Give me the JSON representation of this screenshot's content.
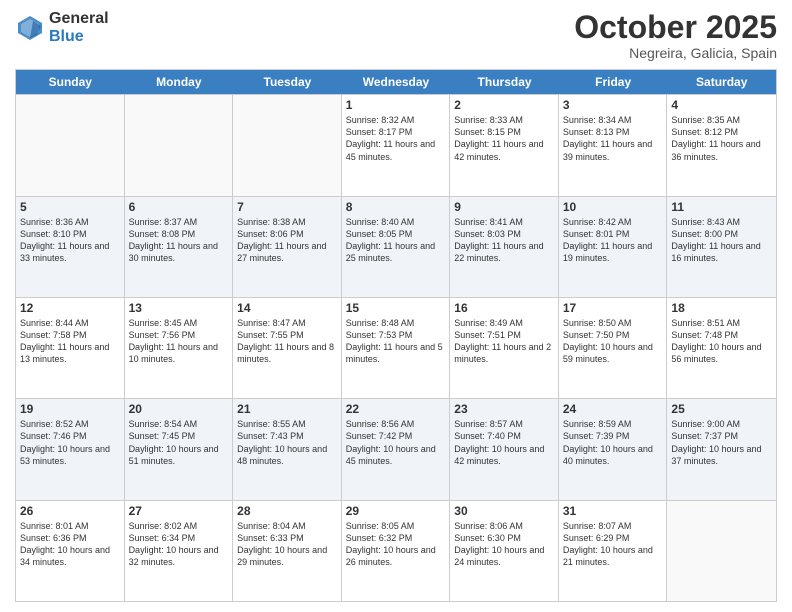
{
  "header": {
    "logo_general": "General",
    "logo_blue": "Blue",
    "month_title": "October 2025",
    "location": "Negreira, Galicia, Spain"
  },
  "calendar": {
    "days_of_week": [
      "Sunday",
      "Monday",
      "Tuesday",
      "Wednesday",
      "Thursday",
      "Friday",
      "Saturday"
    ],
    "rows": [
      [
        {
          "day": "",
          "empty": true
        },
        {
          "day": "",
          "empty": true
        },
        {
          "day": "",
          "empty": true
        },
        {
          "day": "1",
          "sunrise": "Sunrise: 8:32 AM",
          "sunset": "Sunset: 8:17 PM",
          "daylight": "Daylight: 11 hours and 45 minutes."
        },
        {
          "day": "2",
          "sunrise": "Sunrise: 8:33 AM",
          "sunset": "Sunset: 8:15 PM",
          "daylight": "Daylight: 11 hours and 42 minutes."
        },
        {
          "day": "3",
          "sunrise": "Sunrise: 8:34 AM",
          "sunset": "Sunset: 8:13 PM",
          "daylight": "Daylight: 11 hours and 39 minutes."
        },
        {
          "day": "4",
          "sunrise": "Sunrise: 8:35 AM",
          "sunset": "Sunset: 8:12 PM",
          "daylight": "Daylight: 11 hours and 36 minutes."
        }
      ],
      [
        {
          "day": "5",
          "sunrise": "Sunrise: 8:36 AM",
          "sunset": "Sunset: 8:10 PM",
          "daylight": "Daylight: 11 hours and 33 minutes."
        },
        {
          "day": "6",
          "sunrise": "Sunrise: 8:37 AM",
          "sunset": "Sunset: 8:08 PM",
          "daylight": "Daylight: 11 hours and 30 minutes."
        },
        {
          "day": "7",
          "sunrise": "Sunrise: 8:38 AM",
          "sunset": "Sunset: 8:06 PM",
          "daylight": "Daylight: 11 hours and 27 minutes."
        },
        {
          "day": "8",
          "sunrise": "Sunrise: 8:40 AM",
          "sunset": "Sunset: 8:05 PM",
          "daylight": "Daylight: 11 hours and 25 minutes."
        },
        {
          "day": "9",
          "sunrise": "Sunrise: 8:41 AM",
          "sunset": "Sunset: 8:03 PM",
          "daylight": "Daylight: 11 hours and 22 minutes."
        },
        {
          "day": "10",
          "sunrise": "Sunrise: 8:42 AM",
          "sunset": "Sunset: 8:01 PM",
          "daylight": "Daylight: 11 hours and 19 minutes."
        },
        {
          "day": "11",
          "sunrise": "Sunrise: 8:43 AM",
          "sunset": "Sunset: 8:00 PM",
          "daylight": "Daylight: 11 hours and 16 minutes."
        }
      ],
      [
        {
          "day": "12",
          "sunrise": "Sunrise: 8:44 AM",
          "sunset": "Sunset: 7:58 PM",
          "daylight": "Daylight: 11 hours and 13 minutes."
        },
        {
          "day": "13",
          "sunrise": "Sunrise: 8:45 AM",
          "sunset": "Sunset: 7:56 PM",
          "daylight": "Daylight: 11 hours and 10 minutes."
        },
        {
          "day": "14",
          "sunrise": "Sunrise: 8:47 AM",
          "sunset": "Sunset: 7:55 PM",
          "daylight": "Daylight: 11 hours and 8 minutes."
        },
        {
          "day": "15",
          "sunrise": "Sunrise: 8:48 AM",
          "sunset": "Sunset: 7:53 PM",
          "daylight": "Daylight: 11 hours and 5 minutes."
        },
        {
          "day": "16",
          "sunrise": "Sunrise: 8:49 AM",
          "sunset": "Sunset: 7:51 PM",
          "daylight": "Daylight: 11 hours and 2 minutes."
        },
        {
          "day": "17",
          "sunrise": "Sunrise: 8:50 AM",
          "sunset": "Sunset: 7:50 PM",
          "daylight": "Daylight: 10 hours and 59 minutes."
        },
        {
          "day": "18",
          "sunrise": "Sunrise: 8:51 AM",
          "sunset": "Sunset: 7:48 PM",
          "daylight": "Daylight: 10 hours and 56 minutes."
        }
      ],
      [
        {
          "day": "19",
          "sunrise": "Sunrise: 8:52 AM",
          "sunset": "Sunset: 7:46 PM",
          "daylight": "Daylight: 10 hours and 53 minutes."
        },
        {
          "day": "20",
          "sunrise": "Sunrise: 8:54 AM",
          "sunset": "Sunset: 7:45 PM",
          "daylight": "Daylight: 10 hours and 51 minutes."
        },
        {
          "day": "21",
          "sunrise": "Sunrise: 8:55 AM",
          "sunset": "Sunset: 7:43 PM",
          "daylight": "Daylight: 10 hours and 48 minutes."
        },
        {
          "day": "22",
          "sunrise": "Sunrise: 8:56 AM",
          "sunset": "Sunset: 7:42 PM",
          "daylight": "Daylight: 10 hours and 45 minutes."
        },
        {
          "day": "23",
          "sunrise": "Sunrise: 8:57 AM",
          "sunset": "Sunset: 7:40 PM",
          "daylight": "Daylight: 10 hours and 42 minutes."
        },
        {
          "day": "24",
          "sunrise": "Sunrise: 8:59 AM",
          "sunset": "Sunset: 7:39 PM",
          "daylight": "Daylight: 10 hours and 40 minutes."
        },
        {
          "day": "25",
          "sunrise": "Sunrise: 9:00 AM",
          "sunset": "Sunset: 7:37 PM",
          "daylight": "Daylight: 10 hours and 37 minutes."
        }
      ],
      [
        {
          "day": "26",
          "sunrise": "Sunrise: 8:01 AM",
          "sunset": "Sunset: 6:36 PM",
          "daylight": "Daylight: 10 hours and 34 minutes."
        },
        {
          "day": "27",
          "sunrise": "Sunrise: 8:02 AM",
          "sunset": "Sunset: 6:34 PM",
          "daylight": "Daylight: 10 hours and 32 minutes."
        },
        {
          "day": "28",
          "sunrise": "Sunrise: 8:04 AM",
          "sunset": "Sunset: 6:33 PM",
          "daylight": "Daylight: 10 hours and 29 minutes."
        },
        {
          "day": "29",
          "sunrise": "Sunrise: 8:05 AM",
          "sunset": "Sunset: 6:32 PM",
          "daylight": "Daylight: 10 hours and 26 minutes."
        },
        {
          "day": "30",
          "sunrise": "Sunrise: 8:06 AM",
          "sunset": "Sunset: 6:30 PM",
          "daylight": "Daylight: 10 hours and 24 minutes."
        },
        {
          "day": "31",
          "sunrise": "Sunrise: 8:07 AM",
          "sunset": "Sunset: 6:29 PM",
          "daylight": "Daylight: 10 hours and 21 minutes."
        },
        {
          "day": "",
          "empty": true
        }
      ]
    ]
  }
}
